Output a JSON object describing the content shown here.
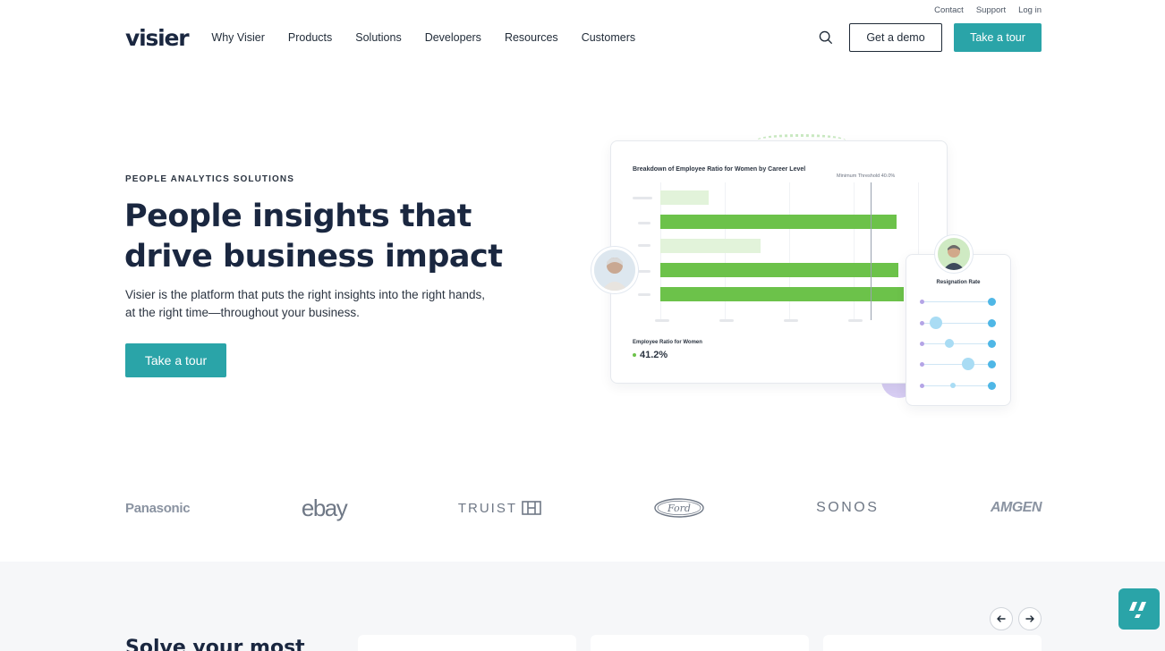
{
  "utility": {
    "contact": "Contact",
    "support": "Support",
    "login": "Log in"
  },
  "header": {
    "logo": "visier",
    "nav": [
      "Why Visier",
      "Products",
      "Solutions",
      "Developers",
      "Resources",
      "Customers"
    ],
    "demo_button": "Get a demo",
    "tour_button": "Take a tour"
  },
  "hero": {
    "eyebrow": "PEOPLE ANALYTICS SOLUTIONS",
    "title_line1": "People insights that",
    "title_line2": "drive business impact",
    "subtitle_line1": "Visier is the platform that puts the right insights into the right hands,",
    "subtitle_line2": "at the right time—throughout your business.",
    "cta": "Take a tour"
  },
  "illustration": {
    "chart_title": "Breakdown of Employee Ratio for Women by Career Level",
    "threshold_label": "Minimum Threshold 40.0%",
    "ratio_label": "Employee Ratio for Women",
    "ratio_value": "41.2%",
    "side_title": "Resignation Rate",
    "colors": {
      "bar_strong": "#6cc24a",
      "bar_light": "#e2f3da",
      "slider": "#4fb7e6"
    }
  },
  "logos": [
    "Panasonic",
    "ebay",
    "TRUIST",
    "Ford",
    "SONOS",
    "AMGEN"
  ],
  "bottom": {
    "title": "Solve your most"
  },
  "colors": {
    "accent": "#2aa4a8",
    "heading": "#1a2740"
  }
}
